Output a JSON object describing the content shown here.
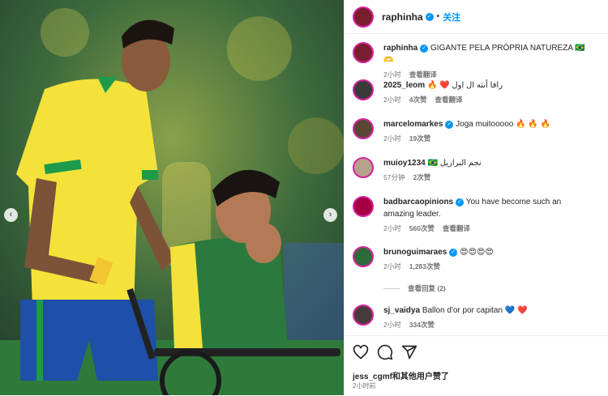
{
  "post": {
    "author": "raphinha",
    "verified_mark": "✓",
    "follow_label": "关注",
    "dot": "•"
  },
  "comments": [
    {
      "user": "raphinha",
      "verified": true,
      "text": "GIGANTE PELA PRÓPRIA NATUREZA 🇧🇷🫶",
      "time": "2小时",
      "likes": "",
      "action": "查看翻译",
      "avatar_color": "#7a1d2f"
    },
    {
      "user": "2025_leom",
      "verified": false,
      "text": "🔥 ❤️ رافا أنته ال اول",
      "time": "2小时",
      "likes": "4次赞",
      "action": "查看翻译",
      "avatar_color": "#3a3a3a"
    },
    {
      "user": "marcelomarkes",
      "verified": true,
      "text": "Joga muitooooo 🔥 🔥 🔥",
      "time": "2小时",
      "likes": "19次赞",
      "action": "",
      "avatar_color": "#5b4636"
    },
    {
      "user": "muioy1234",
      "verified": false,
      "text": "🇧🇷 نجم البرازيل",
      "time": "57分钟",
      "likes": "2次赞",
      "action": "",
      "avatar_color": "#b7a08c"
    },
    {
      "user": "badbarcaopinions",
      "verified": true,
      "text": "You have become such an amazing leader.",
      "time": "2小时",
      "likes": "560次赞",
      "action": "查看翻译",
      "avatar_color": "#a50044"
    },
    {
      "user": "brunoguimaraes",
      "verified": true,
      "text": "😍😍😍😍",
      "time": "2小时",
      "likes": "1,283次赞",
      "action": "",
      "avatar_color": "#2e6b3a"
    },
    {
      "user": "sj_vaidya",
      "verified": false,
      "text": "Ballon d'or por capitan 💙 ❤️",
      "time": "2小时",
      "likes": "334次赞",
      "action": "",
      "avatar_color": "#4a3b3b"
    }
  ],
  "view_replies_label": "查看回复 (2)",
  "likes_summary": {
    "user": "jess_cgmf",
    "rest": "和其他用户赞了"
  },
  "post_time": "2小时前",
  "icons": [
    "heart-icon",
    "comment-icon",
    "share-icon",
    "chevron-left-icon",
    "chevron-right-icon"
  ],
  "nav": {
    "prev": "‹",
    "next": "›"
  },
  "colors": {
    "accent": "#0095f6",
    "heart": "#ed4956",
    "muted": "#737373"
  }
}
